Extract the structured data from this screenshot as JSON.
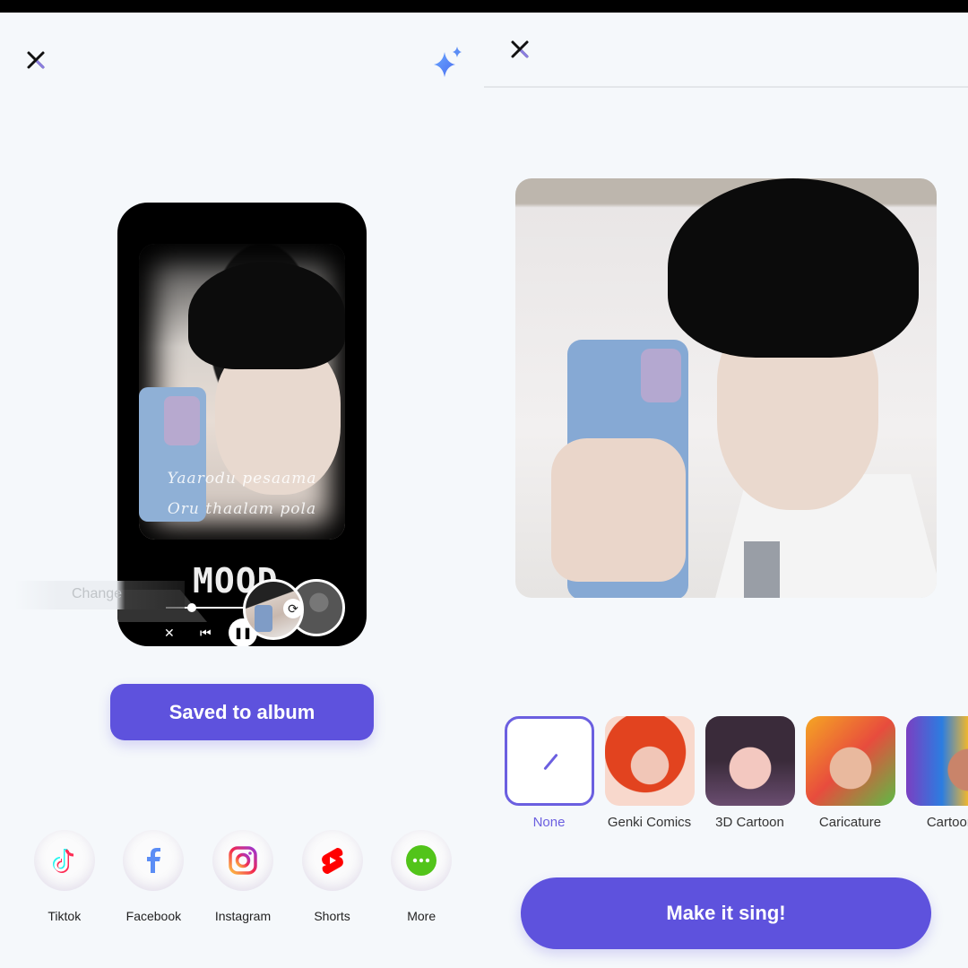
{
  "left_panel": {
    "close_icon": "close-icon",
    "ai_icon": "sparkle-icon",
    "preview": {
      "lyrics_line_1": "Yaarodu pesaama",
      "lyrics_line_2": "Oru thaalam pola",
      "title_art": "MOOD",
      "change_hint": "Change",
      "playback_progress": 0.3,
      "controls": [
        "shuffle-icon",
        "previous-icon",
        "pause-icon"
      ]
    },
    "save_button": "Saved to album",
    "share": [
      {
        "label": "Tiktok",
        "icon": "tiktok-icon"
      },
      {
        "label": "Facebook",
        "icon": "facebook-icon"
      },
      {
        "label": "Instagram",
        "icon": "instagram-icon"
      },
      {
        "label": "Shorts",
        "icon": "youtube-shorts-icon"
      },
      {
        "label": "More",
        "icon": "more-icon"
      }
    ]
  },
  "right_panel": {
    "close_icon": "close-icon",
    "styles": [
      {
        "label": "None",
        "selected": true
      },
      {
        "label": "Genki Comics",
        "selected": false
      },
      {
        "label": "3D Cartoon",
        "selected": false
      },
      {
        "label": "Caricature",
        "selected": false
      },
      {
        "label": "Cartoon",
        "selected": false
      }
    ],
    "primary_button": "Make it sing!"
  },
  "colors": {
    "accent": "#5e52dd",
    "background": "#f5f8fb",
    "selected_outline": "#6b5fe0"
  }
}
